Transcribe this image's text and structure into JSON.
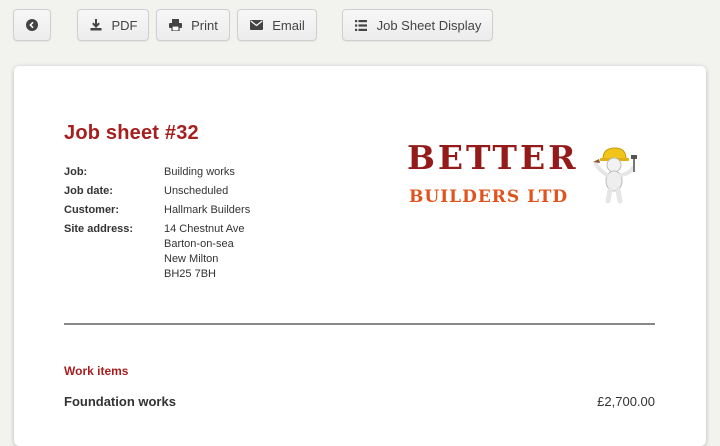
{
  "toolbar": {
    "back_icon": "chevron-left-circle-icon",
    "pdf": {
      "label": "PDF",
      "icon": "download-icon"
    },
    "print": {
      "label": "Print",
      "icon": "printer-icon"
    },
    "email": {
      "label": "Email",
      "icon": "envelope-icon"
    },
    "display": {
      "label": "Job Sheet Display",
      "icon": "list-icon"
    }
  },
  "sheet": {
    "title": "Job sheet #32",
    "details": {
      "job_label": "Job:",
      "job_value": "Building works",
      "date_label": "Job date:",
      "date_value": "Unscheduled",
      "customer_label": "Customer:",
      "customer_value": "Hallmark Builders",
      "site_label": "Site address:",
      "site_lines": [
        "14 Chestnut Ave",
        "Barton-on-sea",
        "New Milton",
        "BH25 7BH"
      ]
    },
    "logo": {
      "line1": "BETTER",
      "line2": "BUILDERS LTD"
    },
    "work_items_title": "Work items",
    "items": [
      {
        "name": "Foundation works",
        "price": "£2,700.00"
      }
    ]
  },
  "colors": {
    "accent_red": "#a61f1f",
    "logo_dark_red": "#951b1b",
    "logo_orange": "#e0531c",
    "background": "#f2f2ef"
  }
}
